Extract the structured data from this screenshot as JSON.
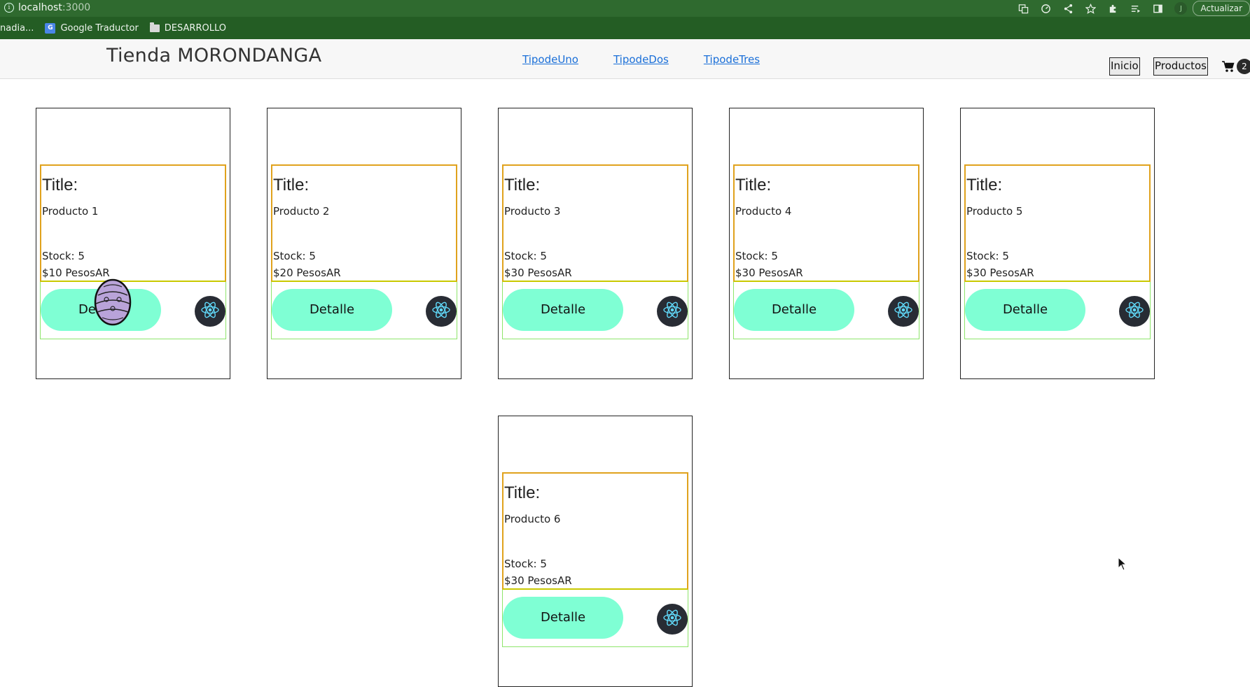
{
  "browser": {
    "address_host": "localhost",
    "address_port": ":3000",
    "update_label": "Actualizar",
    "profile_initial": "J",
    "bookmarks": [
      {
        "label": "nadia..."
      },
      {
        "label": "Google Traductor",
        "icon": "google-translate-icon"
      },
      {
        "label": "DESARROLLO",
        "icon": "folder-icon"
      }
    ]
  },
  "navbar": {
    "brand": "Tienda MORONDANGA",
    "links": [
      "TipodeUno",
      "TipodeDos",
      "TipodeTres"
    ],
    "inicio_label": "Inicio",
    "productos_label": "Productos",
    "cart_count": "2"
  },
  "products": [
    {
      "title_label": "Title:",
      "name": "Producto 1",
      "stock": "Stock: 5",
      "price": "$10 PesosAR",
      "button": "Detalle"
    },
    {
      "title_label": "Title:",
      "name": "Producto 2",
      "stock": "Stock: 5",
      "price": "$20 PesosAR",
      "button": "Detalle"
    },
    {
      "title_label": "Title:",
      "name": "Producto 3",
      "stock": "Stock: 5",
      "price": "$30 PesosAR",
      "button": "Detalle"
    },
    {
      "title_label": "Title:",
      "name": "Producto 4",
      "stock": "Stock: 5",
      "price": "$30 PesosAR",
      "button": "Detalle"
    },
    {
      "title_label": "Title:",
      "name": "Producto 5",
      "stock": "Stock: 5",
      "price": "$30 PesosAR",
      "button": "Detalle"
    },
    {
      "title_label": "Title:",
      "name": "Producto 6",
      "stock": "Stock: 5",
      "price": "$30 PesosAR",
      "button": "Detalle"
    }
  ],
  "colors": {
    "chrome": "#2f6a2f",
    "detalle_button": "#7fffd4",
    "react_button": "#282c34",
    "info_border": "#e0a21d",
    "action_border": "#8ee56b",
    "link": "#1a6fd8"
  }
}
